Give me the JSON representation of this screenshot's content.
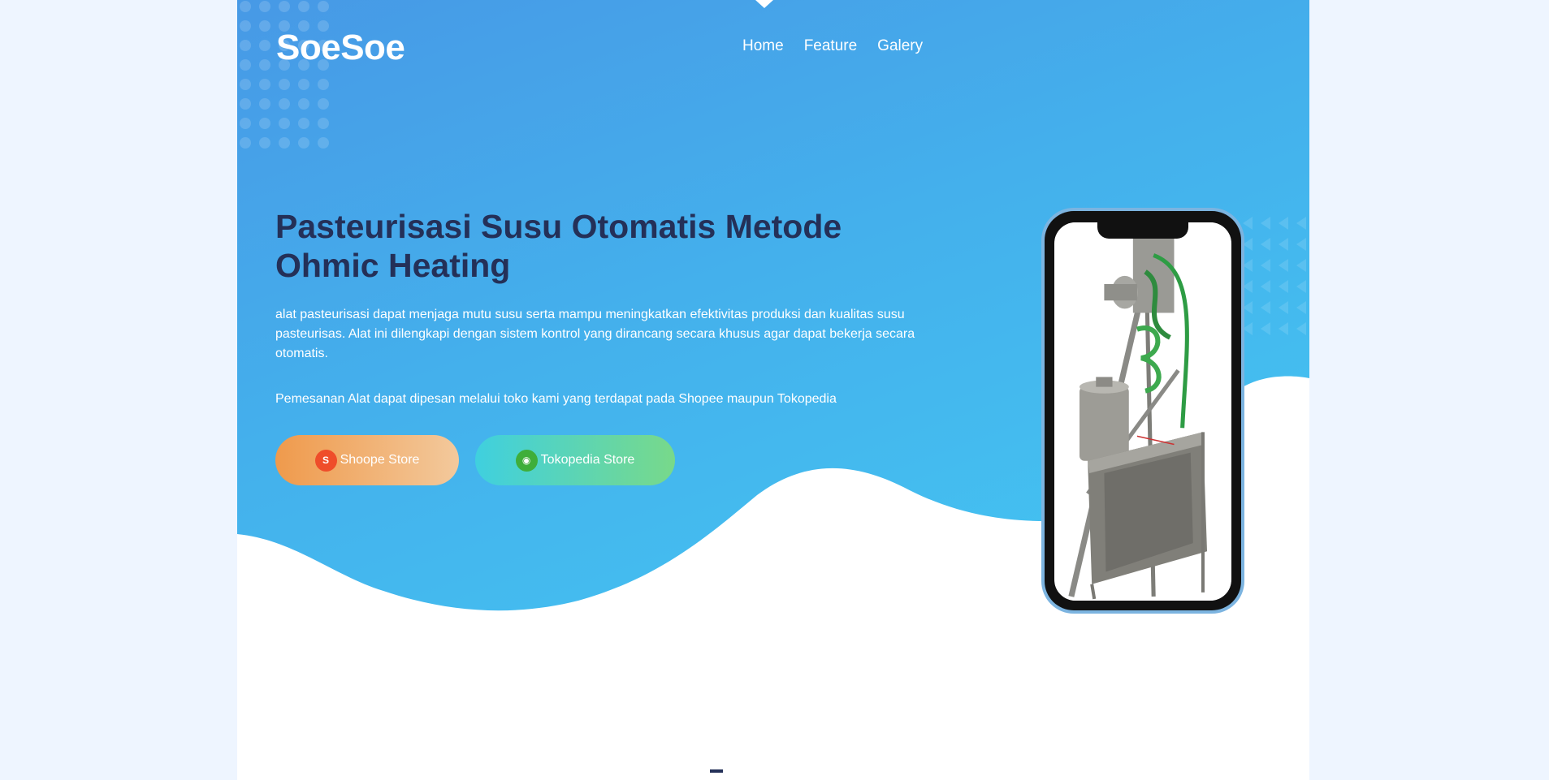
{
  "brand": {
    "logo": "SoeSoe"
  },
  "nav": {
    "items": [
      "Home",
      "Feature",
      "Galery"
    ]
  },
  "hero": {
    "title": "Pasteurisasi Susu Otomatis Metode Ohmic Heating",
    "description": "alat pasteurisasi dapat menjaga mutu susu serta mampu meningkatkan efektivitas produksi dan kualitas susu pasteurisas. Alat ini dilengkapi dengan sistem kontrol yang dirancang secara khusus agar dapat bekerja secara otomatis.",
    "order_text": "Pemesanan Alat dapat dipesan melalui toko kami yang terdapat pada Shopee maupun Tokopedia"
  },
  "buttons": {
    "shopee": {
      "label": "Shoope Store",
      "icon": "shopee-bag-icon"
    },
    "tokopedia": {
      "label": "Tokopedia Store",
      "icon": "tokopedia-bag-icon"
    }
  },
  "colors": {
    "hero_start": "#4799e6",
    "hero_end": "#43c7f2",
    "title": "#243058",
    "shopee_gradient": [
      "#ef9a4c",
      "#f3c99c"
    ],
    "tokopedia_gradient": [
      "#3fd0df",
      "#78d98a"
    ]
  },
  "phone_image": {
    "subject": "pasteurization machine photo"
  }
}
